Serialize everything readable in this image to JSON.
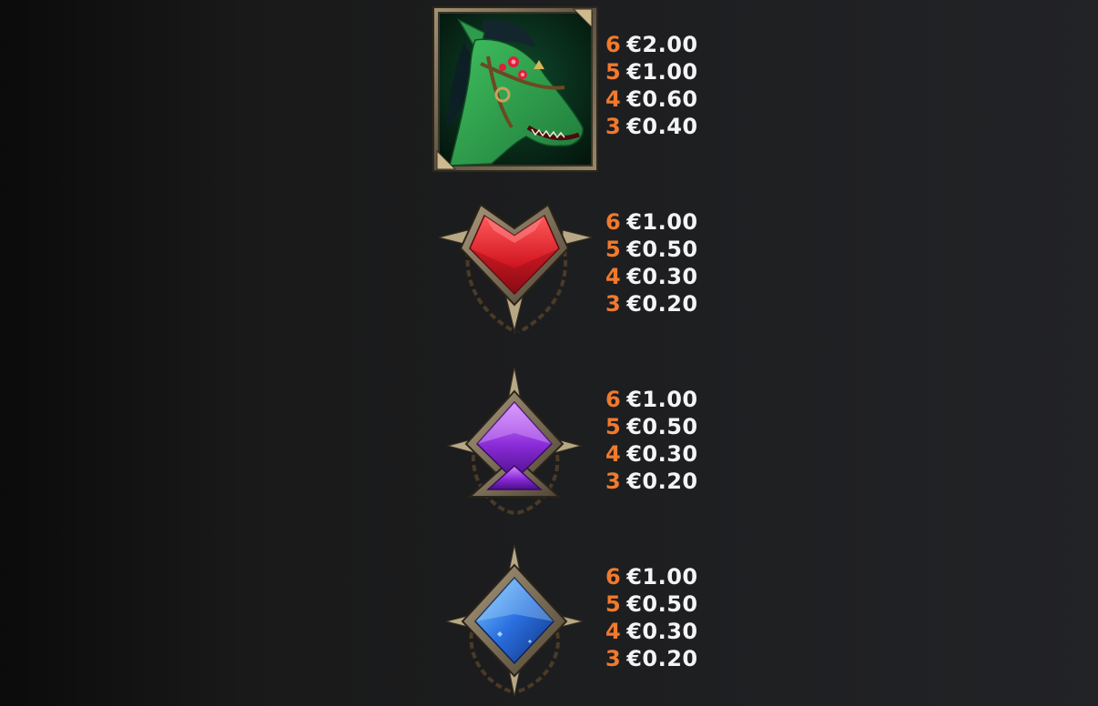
{
  "paytable": {
    "symbols": [
      {
        "icon": "green-horse-icon",
        "payouts": [
          {
            "count": "6",
            "prize": "€2.00"
          },
          {
            "count": "5",
            "prize": "€1.00"
          },
          {
            "count": "4",
            "prize": "€0.60"
          },
          {
            "count": "3",
            "prize": "€0.40"
          }
        ]
      },
      {
        "icon": "red-heart-gem-icon",
        "payouts": [
          {
            "count": "6",
            "prize": "€1.00"
          },
          {
            "count": "5",
            "prize": "€0.50"
          },
          {
            "count": "4",
            "prize": "€0.30"
          },
          {
            "count": "3",
            "prize": "€0.20"
          }
        ]
      },
      {
        "icon": "purple-spade-gem-icon",
        "payouts": [
          {
            "count": "6",
            "prize": "€1.00"
          },
          {
            "count": "5",
            "prize": "€0.50"
          },
          {
            "count": "4",
            "prize": "€0.30"
          },
          {
            "count": "3",
            "prize": "€0.20"
          }
        ]
      },
      {
        "icon": "blue-diamond-gem-icon",
        "payouts": [
          {
            "count": "6",
            "prize": "€1.00"
          },
          {
            "count": "5",
            "prize": "€0.50"
          },
          {
            "count": "4",
            "prize": "€0.30"
          },
          {
            "count": "3",
            "prize": "€0.20"
          }
        ]
      }
    ]
  },
  "colors": {
    "count": "#f07a2e",
    "prize": "#f4f4f4",
    "background": "#1d1e20"
  }
}
